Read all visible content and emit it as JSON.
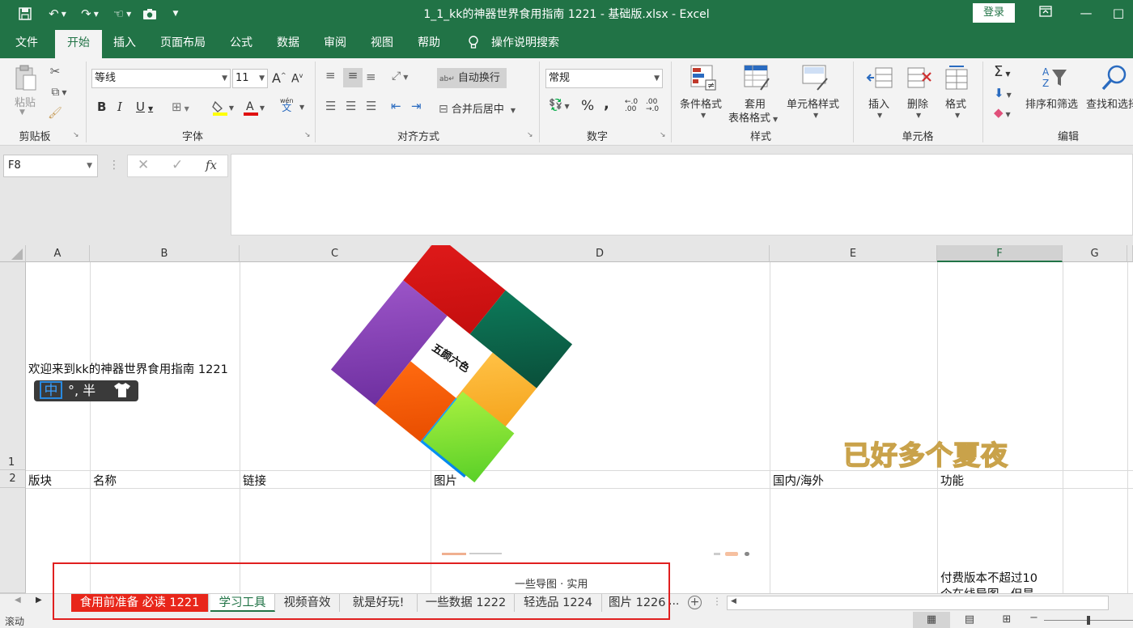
{
  "window": {
    "title": "1_1_kk的神器世界食用指南 1221 - 基础版.xlsx  -  Excel",
    "login_label": "登录"
  },
  "ribbon_tabs": [
    "文件",
    "开始",
    "插入",
    "页面布局",
    "公式",
    "数据",
    "审阅",
    "视图",
    "帮助",
    "操作说明搜索"
  ],
  "ribbon": {
    "clipboard": {
      "paste": "粘贴",
      "group": "剪贴板"
    },
    "font": {
      "name": "等线",
      "size": "11",
      "group": "字体",
      "grow": "A",
      "shrink": "A",
      "bold": "B",
      "italic": "I",
      "underline": "U",
      "phonetic_top": "wén",
      "phonetic_bottom": "文"
    },
    "alignment": {
      "wrap": "自动换行",
      "merge": "合并后居中",
      "group": "对齐方式"
    },
    "number": {
      "format": "常规",
      "group": "数字",
      "percent": "%",
      "comma": ","
    },
    "styles": {
      "conditional": "条件格式",
      "table_line1": "套用",
      "table_line2": "表格格式",
      "cell_styles": "单元格样式",
      "group": "样式"
    },
    "cells": {
      "insert": "插入",
      "delete": "删除",
      "format": "格式",
      "group": "单元格"
    },
    "editing": {
      "sort": "排序和筛选",
      "find": "查找和选择",
      "group": "编辑"
    }
  },
  "formula_bar": {
    "name_box": "F8",
    "fx": "fx",
    "value": ""
  },
  "columns": [
    "A",
    "B",
    "C",
    "D",
    "E",
    "F",
    "G"
  ],
  "rows": [
    "1",
    "2"
  ],
  "cells": {
    "a1": "欢迎来到kk的神器世界食用指南 1221",
    "ime_label": "中",
    "ime_rest": "°, 半",
    "logo_text": "五颜六色",
    "watermark": "已好多个夏夜",
    "headers": [
      "版块",
      "名称",
      "链接",
      "图片",
      "国内/海外",
      "功能"
    ],
    "f3_line1": "付费版本不超过10",
    "f3_line2": "个在线导图，但是",
    "d3_partial": "一些导图 · 实用"
  },
  "sheet_tabs": [
    "食用前准备 必读 1221",
    "学习工具",
    "视频音效",
    "就是好玩!",
    "一些数据 1222",
    "轻选品 1224",
    "图片 1226"
  ],
  "sheet_more": "...",
  "status": {
    "mode": "滚动"
  },
  "colors": {
    "excel_green": "#217346",
    "active_tab_red": "#e8261a",
    "highlight_box": "#e02020"
  }
}
